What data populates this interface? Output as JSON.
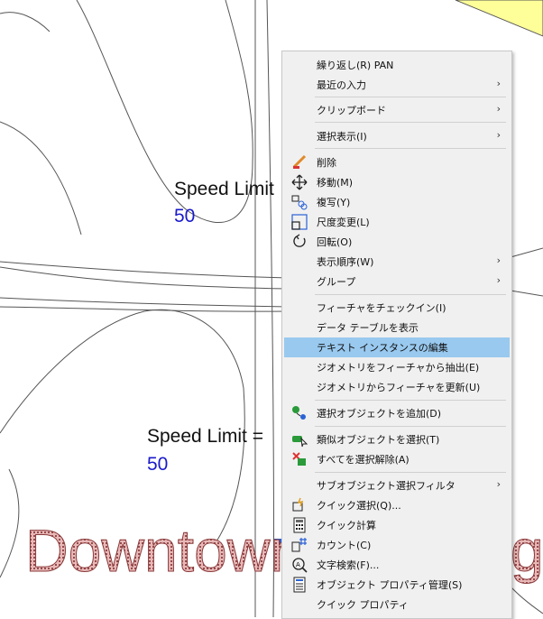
{
  "map": {
    "label1_title": "Speed Limit",
    "label1_value": "50",
    "label2_title": "Speed Limit =",
    "label2_value": "50",
    "big_text": "Downtown",
    "big_text_tail": "g",
    "colors": {
      "blue_value": "#1a1acc",
      "highlight": "#99c9ef",
      "yellow_area": "#ffff99"
    }
  },
  "menu": {
    "items": [
      {
        "label": "繰り返し(R) PAN",
        "icon": "",
        "arrow": ""
      },
      {
        "label": "最近の入力",
        "icon": "",
        "arrow": "›"
      },
      {
        "label": "クリップボード",
        "icon": "",
        "arrow": "›"
      },
      {
        "label": "選択表示(I)",
        "icon": "",
        "arrow": "›"
      },
      {
        "label": "削除",
        "icon": "eraser-icon",
        "arrow": ""
      },
      {
        "label": "移動(M)",
        "icon": "move-icon",
        "arrow": ""
      },
      {
        "label": "複写(Y)",
        "icon": "copy-icon",
        "arrow": ""
      },
      {
        "label": "尺度変更(L)",
        "icon": "scale-icon",
        "arrow": ""
      },
      {
        "label": "回転(O)",
        "icon": "rotate-icon",
        "arrow": ""
      },
      {
        "label": "表示順序(W)",
        "icon": "",
        "arrow": "›"
      },
      {
        "label": "グループ",
        "icon": "",
        "arrow": "›"
      },
      {
        "label": "フィーチャをチェックイン(I)",
        "icon": "",
        "arrow": ""
      },
      {
        "label": "データ テーブルを表示",
        "icon": "",
        "arrow": ""
      },
      {
        "label": "テキスト インスタンスの編集",
        "icon": "",
        "arrow": ""
      },
      {
        "label": "ジオメトリをフィーチャから抽出(E)",
        "icon": "",
        "arrow": ""
      },
      {
        "label": "ジオメトリからフィーチャを更新(U)",
        "icon": "",
        "arrow": ""
      },
      {
        "label": "選択オブジェクトを追加(D)",
        "icon": "add-selected-icon",
        "arrow": ""
      },
      {
        "label": "類似オブジェクトを選択(T)",
        "icon": "select-similar-icon",
        "arrow": ""
      },
      {
        "label": "すべてを選択解除(A)",
        "icon": "deselect-all-icon",
        "arrow": ""
      },
      {
        "label": "サブオブジェクト選択フィルタ",
        "icon": "",
        "arrow": "›"
      },
      {
        "label": "クイック選択(Q)...",
        "icon": "quick-select-icon",
        "arrow": ""
      },
      {
        "label": "クイック計算",
        "icon": "calculator-icon",
        "arrow": ""
      },
      {
        "label": "カウント(C)",
        "icon": "count-icon",
        "arrow": ""
      },
      {
        "label": "文字検索(F)...",
        "icon": "find-text-icon",
        "arrow": ""
      },
      {
        "label": "オブジェクト プロパティ管理(S)",
        "icon": "properties-icon",
        "arrow": ""
      },
      {
        "label": "クイック プロパティ",
        "icon": "",
        "arrow": ""
      }
    ]
  }
}
